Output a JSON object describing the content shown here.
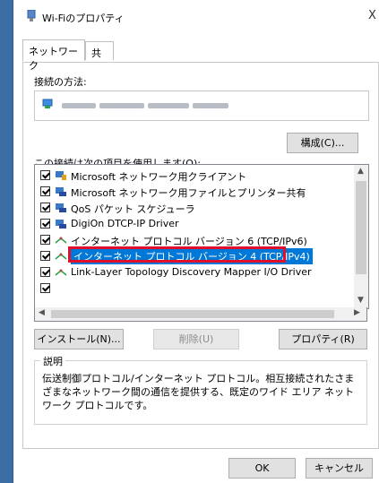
{
  "window": {
    "title": "Wi-Fiのプロパティ",
    "close_glyph": "X"
  },
  "tabs": [
    {
      "label": "ネットワーク"
    },
    {
      "label": "共有"
    }
  ],
  "connection": {
    "label": "接続の方法:"
  },
  "buttons": {
    "configure": "構成(C)...",
    "install": "インストール(N)...",
    "uninstall": "削除(U)",
    "properties": "プロパティ(R)",
    "ok": "OK",
    "cancel": "キャンセル"
  },
  "items_label": "この接続は次の項目を使用します(O):",
  "items": [
    {
      "label": "Microsoft ネットワーク用クライアント",
      "icon": "network-client-icon"
    },
    {
      "label": "Microsoft ネットワーク用ファイルとプリンター共有",
      "icon": "file-printer-share-icon"
    },
    {
      "label": "QoS パケット スケジューラ",
      "icon": "qos-icon"
    },
    {
      "label": "DigiOn DTCP-IP Driver",
      "icon": "driver-icon"
    },
    {
      "label": "インターネット プロトコル バージョン 6 (TCP/IPv6)",
      "icon": "protocol-icon"
    },
    {
      "label": "インターネット プロトコル バージョン 4 (TCP/IPv4)",
      "icon": "protocol-icon"
    },
    {
      "label": "Link-Layer Topology Discovery Mapper I/O Driver",
      "icon": "protocol-icon"
    }
  ],
  "description": {
    "title": "説明",
    "text": "伝送制御プロトコル/インターネット プロトコル。相互接続されたさまざまなネットワーク間の通信を提供する、既定のワイド エリア ネットワーク プロトコルです。"
  },
  "colors": {
    "selection": "#0078d7",
    "highlight_border": "#e0102b"
  }
}
